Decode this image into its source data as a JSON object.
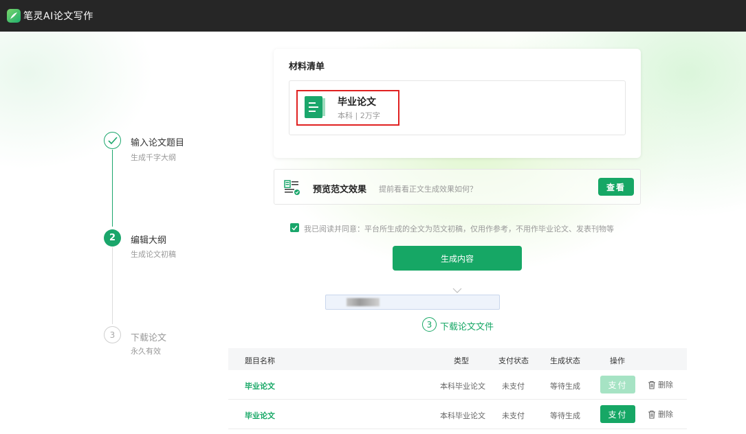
{
  "app": {
    "title": "笔灵AI论文写作"
  },
  "steps": [
    {
      "num": "",
      "title": "输入论文题目",
      "subtitle": "生成千字大纲",
      "state": "done"
    },
    {
      "num": "2",
      "title": "编辑大纲",
      "subtitle": "生成论文初稿",
      "state": "active"
    },
    {
      "num": "3",
      "title": "下载论文",
      "subtitle": "永久有效",
      "state": "pending"
    }
  ],
  "materials": {
    "title": "材料清单",
    "doc": {
      "name": "毕业论文",
      "meta": "本科 | 2万字"
    }
  },
  "preview": {
    "title": "预览范文效果",
    "hint": "提前看看正文生成效果如何？",
    "button": "查看"
  },
  "agreement": {
    "checked": true,
    "text": "我已阅读并同意：平台所生成的全文为范文初稿，仅用作参考，不用作毕业论文、发表刊物等"
  },
  "generate_button": "生成内容",
  "download": {
    "num": "3",
    "label": "下载论文文件"
  },
  "table": {
    "headers": {
      "name": "题目名称",
      "type": "类型",
      "pay": "支付状态",
      "gen": "生成状态",
      "action": "操作"
    },
    "rows": [
      {
        "name": "毕业论文",
        "type": "本科毕业论文",
        "pay": "未支付",
        "gen": "等待生成",
        "pay_btn": "支付",
        "pay_enabled": false,
        "delete": "删除"
      },
      {
        "name": "毕业论文",
        "type": "本科毕业论文",
        "pay": "未支付",
        "gen": "等待生成",
        "pay_btn": "支付",
        "pay_enabled": true,
        "delete": "删除"
      }
    ]
  },
  "colors": {
    "accent": "#16a765",
    "highlight": "#e02020",
    "topbar": "#262626"
  }
}
